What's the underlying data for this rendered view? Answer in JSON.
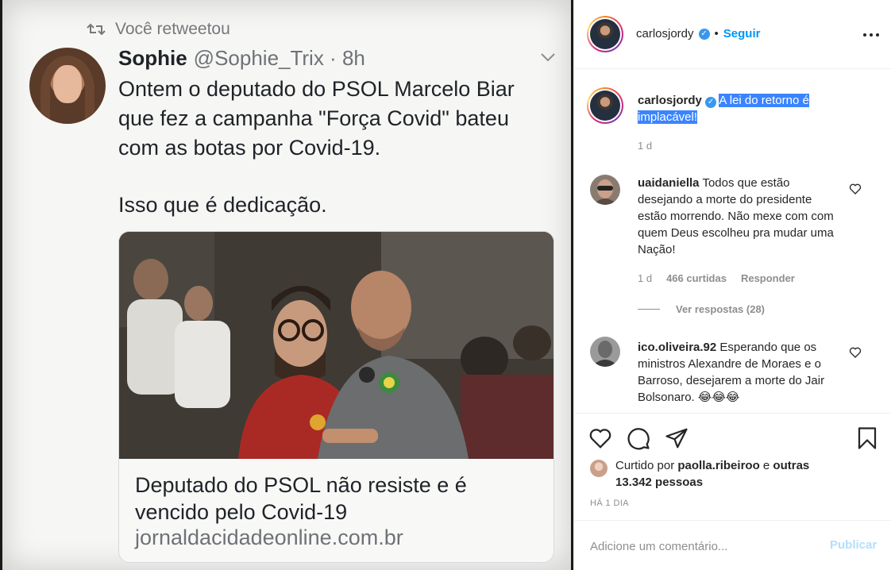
{
  "retweet": {
    "retweeted_label": "Você retweetou",
    "name": "Sophie",
    "handle_time": "@Sophie_Trix · 8h",
    "text_lines": [
      "Ontem o deputado do PSOL Marcelo Biar",
      "que fez a campanha \"Força Covid\" bateu",
      "com as botas por Covid-19.",
      "Isso que é dedicação."
    ],
    "link_card": {
      "title": "Deputado do PSOL não resiste e é vencido pelo Covid-19",
      "domain": "jornaldacidadeonline.com.br"
    }
  },
  "post": {
    "header": {
      "username": "carlosjordy",
      "separator": "•",
      "follow_label": "Seguir"
    },
    "caption": {
      "username": "carlosjordy",
      "text": "A lei do retorno é implacável!",
      "time": "1 d"
    },
    "comments": [
      {
        "username": "uaidaniella",
        "text": "Todos que estão desejando a morte do presidente estão morrendo. Não mexe com com quem Deus escolheu pra mudar uma Nação!",
        "time": "1 d",
        "likes": "466 curtidas",
        "reply_label": "Responder",
        "view_replies": "Ver respostas (28)"
      },
      {
        "username": "ico.oliveira.92",
        "text": "Esperando que os ministros Alexandre de Moraes e o Barroso, desejarem a morte do Jair Bolsonaro. 😂😂😂"
      }
    ],
    "likes_summary": {
      "prefix": "Curtido por ",
      "user": "paolla.ribeiroo",
      "middle": " e ",
      "others": "outras 13.342 pessoas"
    },
    "time_ago": "HÁ 1 DIA",
    "comment_box": {
      "placeholder": "Adicione um comentário...",
      "publish_label": "Publicar"
    }
  },
  "icons": {
    "retweet": "retweet-icon",
    "chevron": "chevron-down-icon",
    "verified": "verified-badge-icon",
    "more": "more-options-icon",
    "heart": "heart-icon",
    "comment": "comment-icon",
    "share": "share-icon",
    "save": "bookmark-icon"
  },
  "colors": {
    "accent": "#0095f6",
    "verified": "#3897f0",
    "selection": "#3a84ff",
    "publish_disabled": "#b2dffc"
  }
}
